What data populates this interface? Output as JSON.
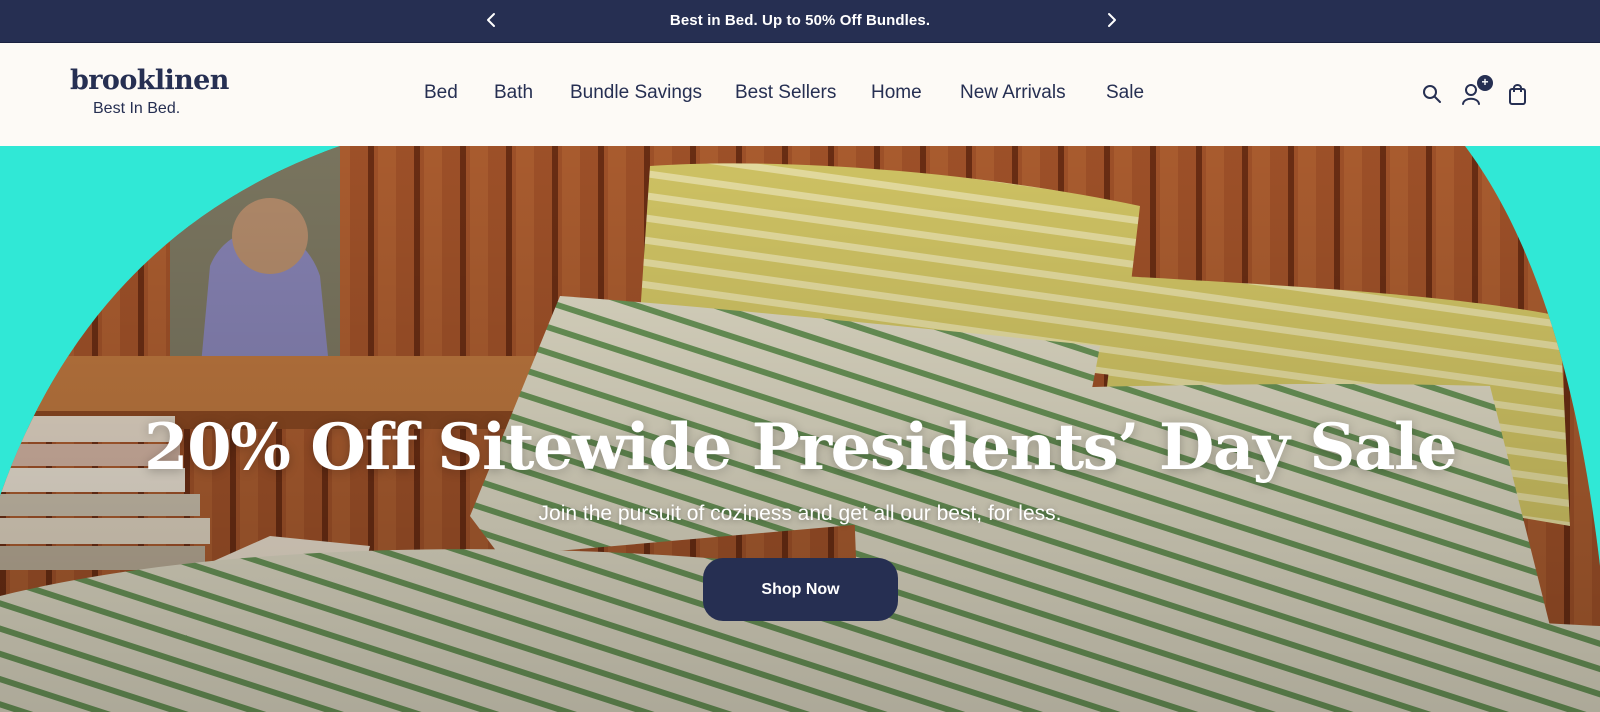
{
  "announcement": {
    "text": "Best in Bed. Up to 50% Off Bundles.",
    "prev_icon": "chevron-left-icon",
    "next_icon": "chevron-right-icon"
  },
  "header": {
    "logo_word": "brooklinen",
    "logo_tagline": "Best In Bed.",
    "nav": [
      "Bed",
      "Bath",
      "Bundle Savings",
      "Best Sellers",
      "Home",
      "New Arrivals",
      "Sale"
    ],
    "icons": {
      "search": "search-icon",
      "account": "account-icon",
      "cart": "shopping-bag-icon"
    },
    "account_badge": "+"
  },
  "hero": {
    "title": "20% Off Sitewide Presidents’ Day Sale",
    "subtitle": "Join the pursuit of coziness and get all our best, for less.",
    "cta": "Shop Now"
  },
  "colors": {
    "navy": "#262f52",
    "cream": "#fdfaf6",
    "teal": "#30e8d6"
  }
}
